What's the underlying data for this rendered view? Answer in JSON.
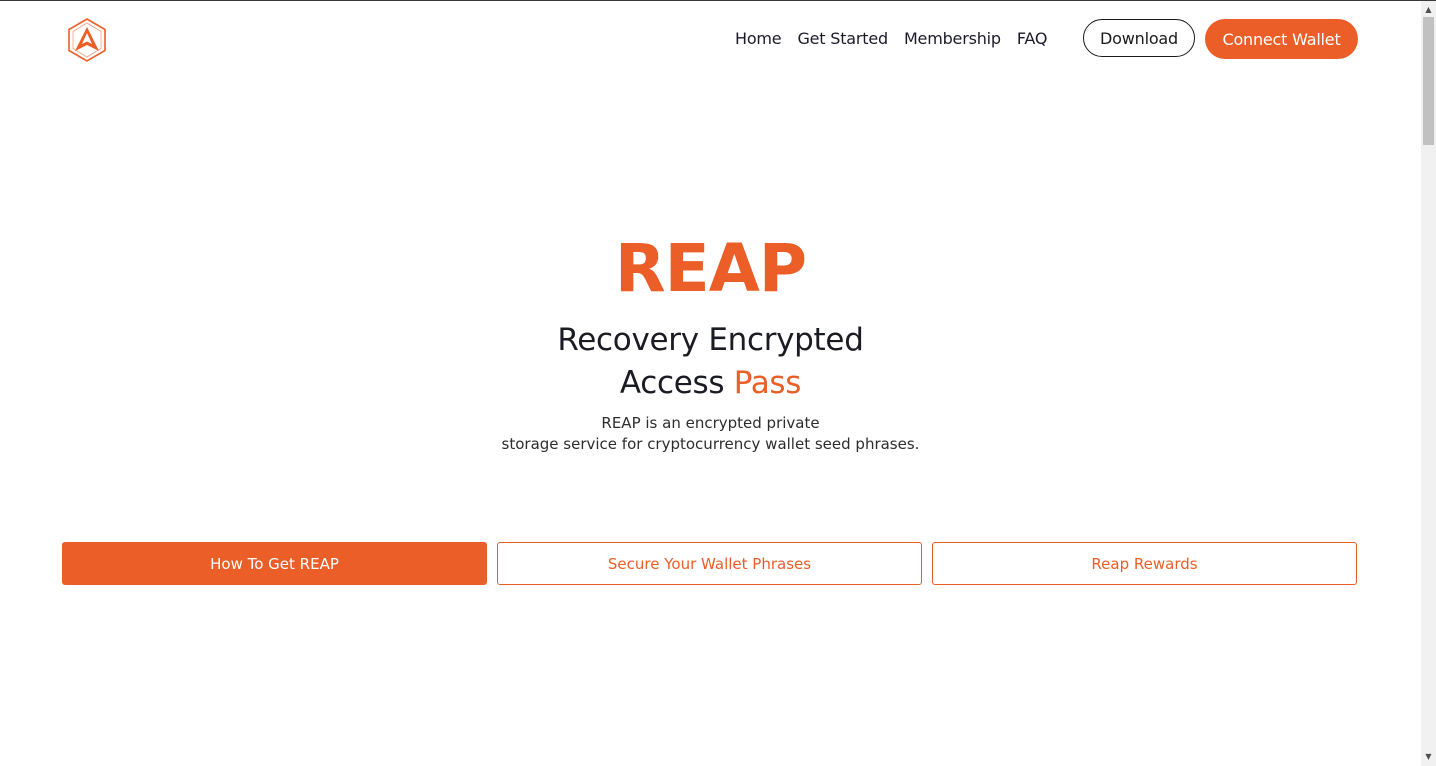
{
  "header": {
    "logo_icon": "reap-hexagon-logo",
    "nav": [
      {
        "label": "Home"
      },
      {
        "label": "Get Started"
      },
      {
        "label": "Membership"
      },
      {
        "label": "FAQ"
      }
    ],
    "download_label": "Download",
    "connect_label": "Connect Wallet"
  },
  "hero": {
    "title": "REAP",
    "subtitle_line1": "Recovery Encrypted",
    "subtitle_line2_part1": "Access ",
    "subtitle_line2_accent": "Pass",
    "desc_line1": "REAP is an encrypted private",
    "desc_line2": "storage service for cryptocurrency wallet seed phrases."
  },
  "tabs": [
    {
      "label": "How To Get REAP",
      "active": true
    },
    {
      "label": "Secure Your Wallet Phrases",
      "active": false
    },
    {
      "label": "Reap Rewards",
      "active": false
    }
  ],
  "colors": {
    "accent": "#eb5e28",
    "text": "#1b1b24",
    "background": "#ffffff"
  }
}
